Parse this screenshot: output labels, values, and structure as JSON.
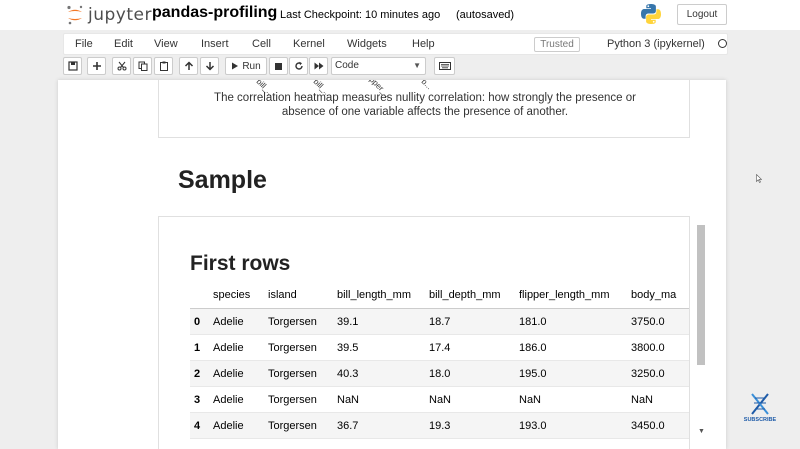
{
  "header": {
    "logo_text": "jupyter",
    "notebook_name": "pandas-profiling",
    "checkpoint": "Last Checkpoint: 10 minutes ago",
    "autosave": "(autosaved)",
    "logout_label": "Logout"
  },
  "menubar": {
    "items": [
      "File",
      "Edit",
      "View",
      "Insert",
      "Cell",
      "Kernel",
      "Widgets",
      "Help"
    ],
    "trusted": "Trusted",
    "kernel": "Python 3 (ipykernel)"
  },
  "toolbar": {
    "run_label": "Run",
    "cell_type": "Code"
  },
  "output_1": {
    "tilted_labels": [
      "bill_...",
      "bill_...",
      "flipper_...",
      "b..."
    ],
    "caption_line1": "The correlation heatmap measures nullity correlation: how strongly the presence or",
    "caption_line2": "absence of one variable affects the presence of another."
  },
  "sample": {
    "heading": "Sample",
    "sub_heading": "First rows",
    "columns": [
      "",
      "species",
      "island",
      "bill_length_mm",
      "bill_depth_mm",
      "flipper_length_mm",
      "body_ma"
    ],
    "rows": [
      [
        "0",
        "Adelie",
        "Torgersen",
        "39.1",
        "18.7",
        "181.0",
        "3750.0"
      ],
      [
        "1",
        "Adelie",
        "Torgersen",
        "39.5",
        "17.4",
        "186.0",
        "3800.0"
      ],
      [
        "2",
        "Adelie",
        "Torgersen",
        "40.3",
        "18.0",
        "195.0",
        "3250.0"
      ],
      [
        "3",
        "Adelie",
        "Torgersen",
        "NaN",
        "NaN",
        "NaN",
        "NaN"
      ],
      [
        "4",
        "Adelie",
        "Torgersen",
        "36.7",
        "19.3",
        "193.0",
        "3450.0"
      ]
    ]
  },
  "overlay": {
    "subscribe_text": "SUBSCRIBE"
  },
  "colors": {
    "jupyter_orange": "#f37726",
    "python_blue": "#3776ab",
    "python_yellow": "#ffd43b"
  }
}
